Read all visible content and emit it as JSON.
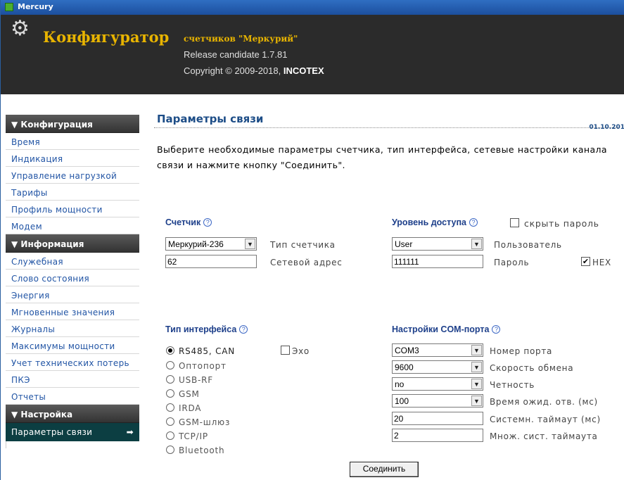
{
  "window": {
    "title": "Mercury"
  },
  "header": {
    "brand": "Конфигуратор",
    "subtitle": "счетчиков \"Меркурий\"",
    "release": "Release candidate 1.7.81",
    "copyright_prefix": "Copyright © 2009-2018, ",
    "copyright_company": "INCOTEX"
  },
  "sidebar": {
    "sections": [
      {
        "label": "▼ Конфигурация",
        "items": [
          "Время",
          "Индикация",
          "Управление нагрузкой",
          "Тарифы",
          "Профиль мощности",
          "Модем"
        ]
      },
      {
        "label": "▼ Информация",
        "items": [
          "Служебная",
          "Слово состояния",
          "Энергия",
          "Мгновенные значения",
          "Журналы",
          "Максимумы мощности",
          "Учет технических потерь",
          "ПКЭ",
          "Отчеты"
        ]
      },
      {
        "label": "▼ Настройка",
        "items": [
          "Параметры связи"
        ]
      }
    ],
    "active_item": "Параметры связи"
  },
  "page": {
    "title": "Параметры связи",
    "date": "01.10.201",
    "intro": "Выберите необходимые параметры счетчика, тип интерфейса, сетевые настройки канала связи и нажмите кнопку \"Соединить\"."
  },
  "meter": {
    "label": "Счетчик",
    "type_value": "Меркурий-236",
    "type_label": "Тип счетчика",
    "address_value": "62",
    "address_label": "Сетевой адрес"
  },
  "access": {
    "label": "Уровень доступа",
    "hide_password_label": "скрыть пароль",
    "hide_password_checked": false,
    "level_value": "User",
    "level_label": "Пользователь",
    "password_value": "111111",
    "password_label": "Пароль",
    "hex_label": "HEX",
    "hex_checked": true
  },
  "interface": {
    "label": "Тип интерфейса",
    "options": [
      "RS485, CAN",
      "Оптопорт",
      "USB-RF",
      "GSM",
      "IRDA",
      "GSM-шлюз",
      "TCP/IP",
      "Bluetooth"
    ],
    "selected": "RS485, CAN",
    "echo_label": "Эхо",
    "echo_checked": false
  },
  "com": {
    "label": "Настройки COM-порта",
    "port_value": "COM3",
    "port_label": "Номер порта",
    "speed_value": "9600",
    "speed_label": "Скорость обмена",
    "parity_value": "no",
    "parity_label": "Четность",
    "wait_value": "100",
    "wait_label": "Время ожид. отв. (мс)",
    "systimeout_value": "20",
    "systimeout_label": "Системн. таймаут (мс)",
    "multiplier_value": "2",
    "multiplier_label": "Множ. сист. таймаута"
  },
  "buttons": {
    "connect": "Соединить"
  },
  "icons": {
    "help": "?",
    "dropdown": "▼",
    "check": "✔",
    "arrow": "➡",
    "gear": "⚙"
  }
}
